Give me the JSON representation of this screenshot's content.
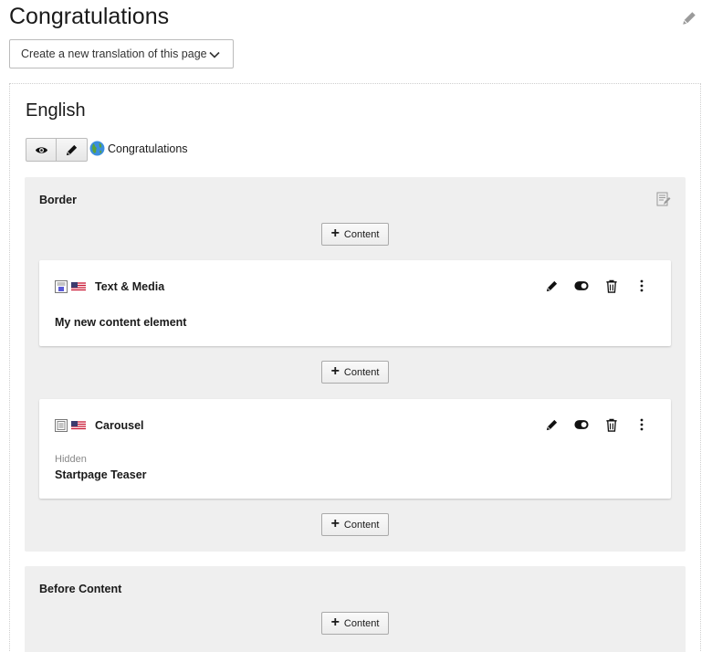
{
  "page": {
    "title": "Congratulations",
    "translation_dropdown": "Create a new translation of this page"
  },
  "language": {
    "name": "English",
    "page_link": "Congratulations"
  },
  "columns": [
    {
      "title": "Border",
      "add_label": "Content",
      "elements": [
        {
          "type": "Text & Media",
          "header": "My new content element",
          "status": ""
        },
        {
          "type": "Carousel",
          "header": "Startpage Teaser",
          "status": "Hidden"
        }
      ]
    },
    {
      "title": "Before Content",
      "add_label": "Content"
    }
  ],
  "icons": {
    "title_edit": "pencil-icon",
    "view": "eye-icon",
    "edit": "pencil-icon",
    "globe": "globe-icon",
    "column_edit": "edit-column-icon",
    "element_actions": [
      "pencil-icon",
      "toggle-icon",
      "trash-icon",
      "more-vertical-icon"
    ],
    "flag": "us-flag-icon"
  },
  "colors": {
    "column_bg": "#efefef",
    "card_bg": "#ffffff"
  }
}
